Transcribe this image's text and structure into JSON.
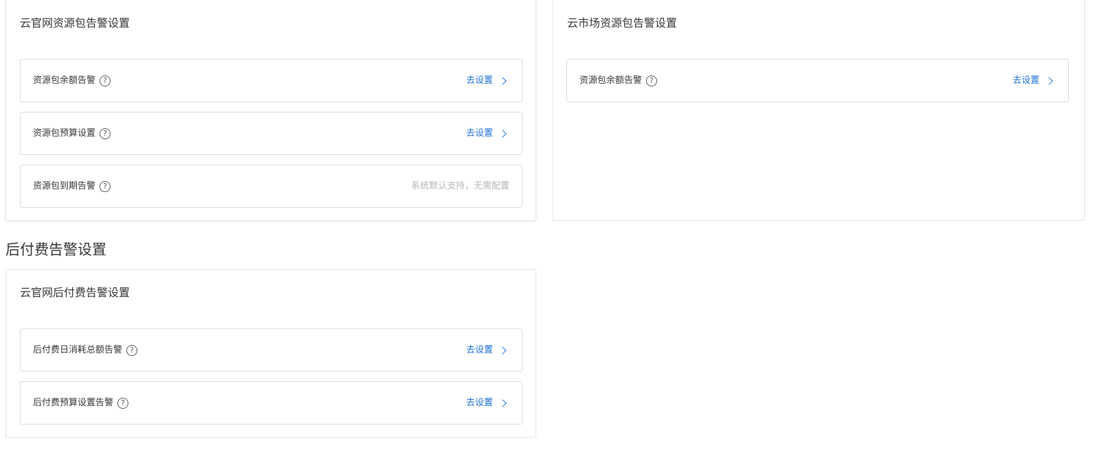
{
  "official_pkg": {
    "title": "云官网资源包告警设置",
    "rows": [
      {
        "label": "资源包余额告警",
        "action": "去设置"
      },
      {
        "label": "资源包预算设置",
        "action": "去设置"
      },
      {
        "label": "资源包到期告警",
        "note": "系统默认支持，无需配置"
      }
    ]
  },
  "market_pkg": {
    "title": "云市场资源包告警设置",
    "rows": [
      {
        "label": "资源包余额告警",
        "action": "去设置"
      }
    ]
  },
  "postpaid": {
    "section_title": "后付费告警设置",
    "title": "云官网后付费告警设置",
    "rows": [
      {
        "label": "后付费日消耗总额告警",
        "action": "去设置"
      },
      {
        "label": "后付费预算设置告警",
        "action": "去设置"
      }
    ]
  },
  "icons": {
    "help": "?"
  },
  "colors": {
    "link": "#1a6fd6",
    "note": "#b5b5b5",
    "border": "#d9d9d9"
  }
}
